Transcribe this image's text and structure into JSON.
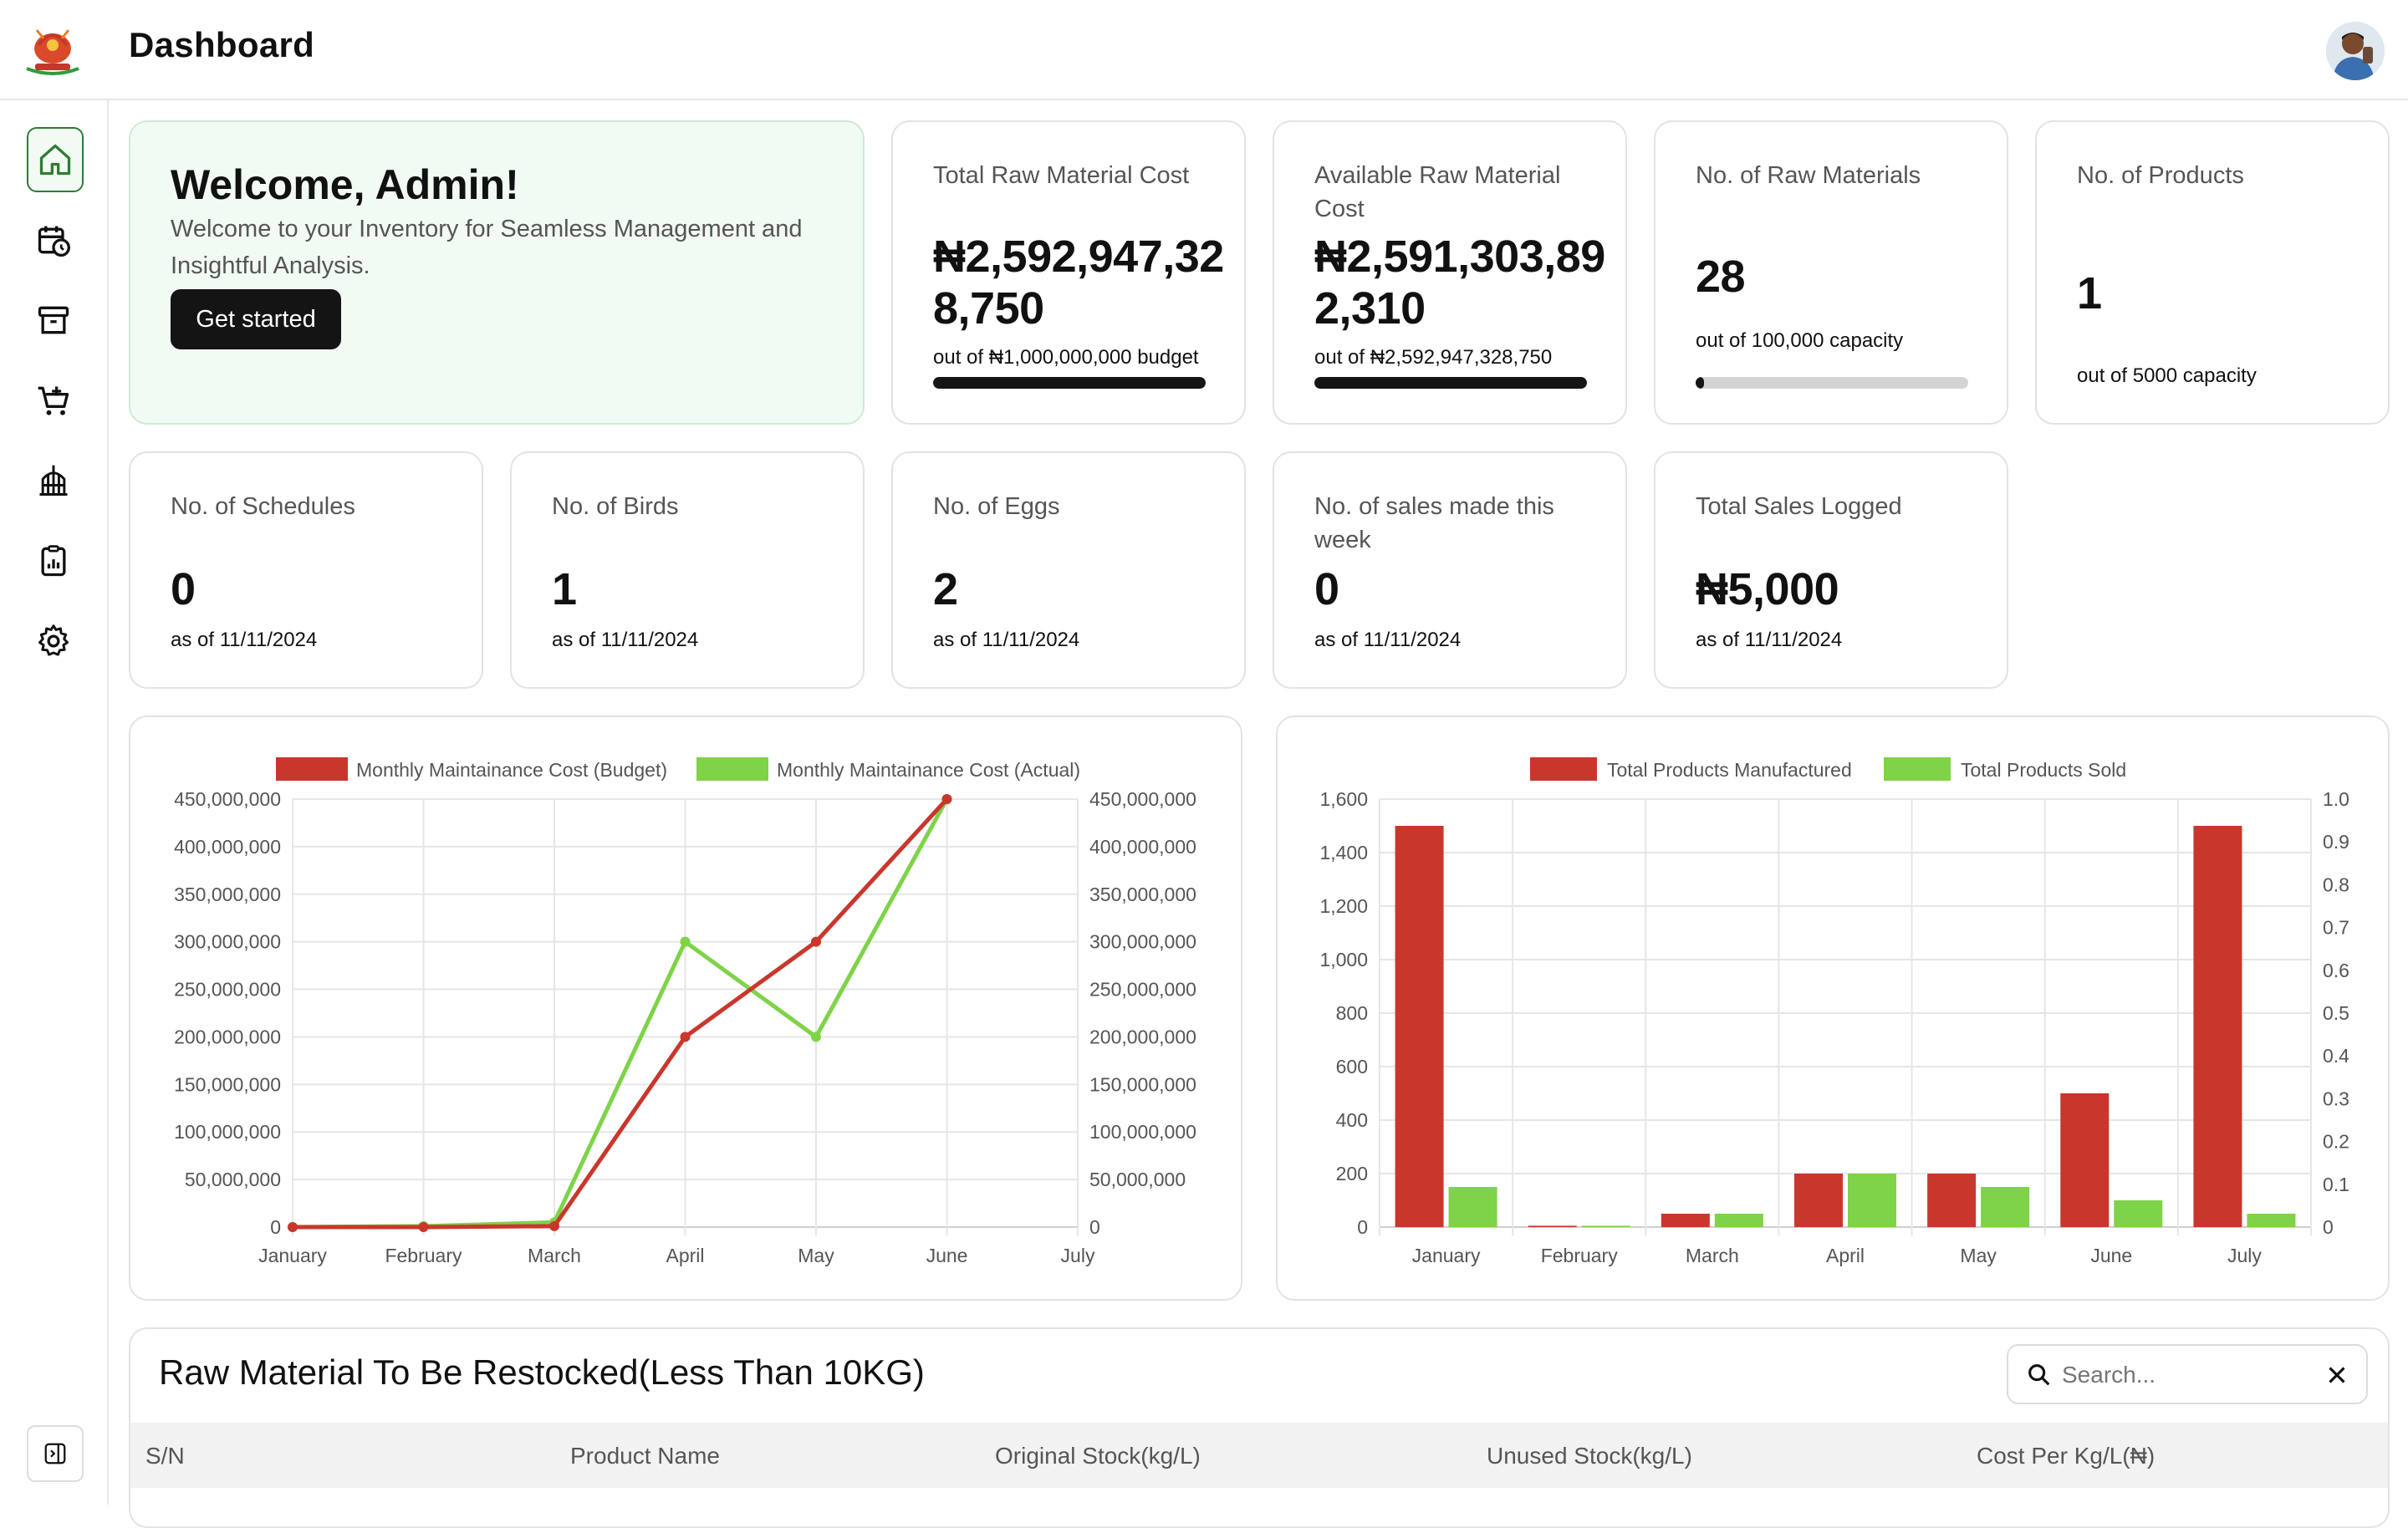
{
  "header": {
    "title": "Dashboard"
  },
  "sidebar": {
    "items": [
      {
        "icon": "home-icon",
        "active": true
      },
      {
        "icon": "calendar-clock-icon"
      },
      {
        "icon": "archive-box-icon"
      },
      {
        "icon": "cart-add-icon"
      },
      {
        "icon": "bird-cage-icon"
      },
      {
        "icon": "clipboard-report-icon"
      },
      {
        "icon": "gear-icon"
      }
    ],
    "collapse_icon": "sidebar-toggle-icon"
  },
  "welcome": {
    "title": "Welcome, Admin!",
    "text": "Welcome to your Inventory for Seamless Management and Insightful Analysis.",
    "button": "Get started"
  },
  "stats_row1": [
    {
      "label": "Total Raw Material Cost",
      "value": "₦2,592,947,32\n8,750",
      "sub": "out of ₦1,000,000,000 budget",
      "progress": 1.0
    },
    {
      "label": "Available Raw Material Cost",
      "value": "₦2,591,303,89\n2,310",
      "sub": "out of ₦2,592,947,328,750",
      "progress": 1.0
    },
    {
      "label": "No. of Raw Materials",
      "value": "28",
      "sub": "out of 100,000 capacity",
      "progress": 0.03
    },
    {
      "label": "No. of Products",
      "value": "1",
      "sub": "out of 5000 capacity"
    }
  ],
  "stats_row2": [
    {
      "label": "No. of Schedules",
      "value": "0",
      "sub": "as of 11/11/2024"
    },
    {
      "label": "No. of Birds",
      "value": "1",
      "sub": "as of 11/11/2024"
    },
    {
      "label": "No. of Eggs",
      "value": "2",
      "sub": "as of 11/11/2024"
    },
    {
      "label": "No. of sales made this week",
      "value": "0",
      "sub": "as of 11/11/2024"
    },
    {
      "label": "Total Sales Logged",
      "value": "₦5,000",
      "sub": "as of 11/11/2024"
    }
  ],
  "chart_data": [
    {
      "type": "line",
      "categories": [
        "January",
        "February",
        "March",
        "April",
        "May",
        "June",
        "July"
      ],
      "series": [
        {
          "name": "Monthly Maintainance Cost (Budget)",
          "color": "#c9372c",
          "values": [
            0,
            0,
            1000000,
            200000000,
            300000000,
            450000000,
            null
          ]
        },
        {
          "name": "Monthly Maintainance Cost (Actual)",
          "color": "#7ed348",
          "values": [
            0,
            1000000,
            5000000,
            300000000,
            200000000,
            450000000,
            null
          ]
        }
      ],
      "ylim": [
        0,
        450000000
      ],
      "y_ticks": [
        "0",
        "50,000,000",
        "100,000,000",
        "150,000,000",
        "200,000,000",
        "250,000,000",
        "300,000,000",
        "350,000,000",
        "400,000,000",
        "450,000,000"
      ],
      "legend": "top",
      "grid": true
    },
    {
      "type": "bar",
      "categories": [
        "January",
        "February",
        "March",
        "April",
        "May",
        "June",
        "July"
      ],
      "series": [
        {
          "name": "Total Products Manufactured",
          "color": "#c9372c",
          "values": [
            1500,
            5,
            50,
            200,
            200,
            500,
            1500
          ]
        },
        {
          "name": "Total Products Sold",
          "color": "#7ed348",
          "values": [
            150,
            5,
            50,
            200,
            150,
            100,
            50
          ]
        }
      ],
      "ylim": [
        0,
        1600
      ],
      "y_ticks": [
        "0",
        "200",
        "400",
        "600",
        "800",
        "1,000",
        "1,200",
        "1,400",
        "1,600"
      ],
      "y2_ticks": [
        "0",
        "0.1",
        "0.2",
        "0.3",
        "0.4",
        "0.5",
        "0.6",
        "0.7",
        "0.8",
        "0.9",
        "1.0"
      ],
      "legend": "top",
      "grid": true
    }
  ],
  "table": {
    "title": "Raw Material To Be Restocked(Less Than 10KG)",
    "search_placeholder": "Search...",
    "columns": [
      "S/N",
      "Product Name",
      "Original Stock(kg/L)",
      "Unused Stock(kg/L)",
      "Cost Per Kg/L(₦)"
    ]
  }
}
